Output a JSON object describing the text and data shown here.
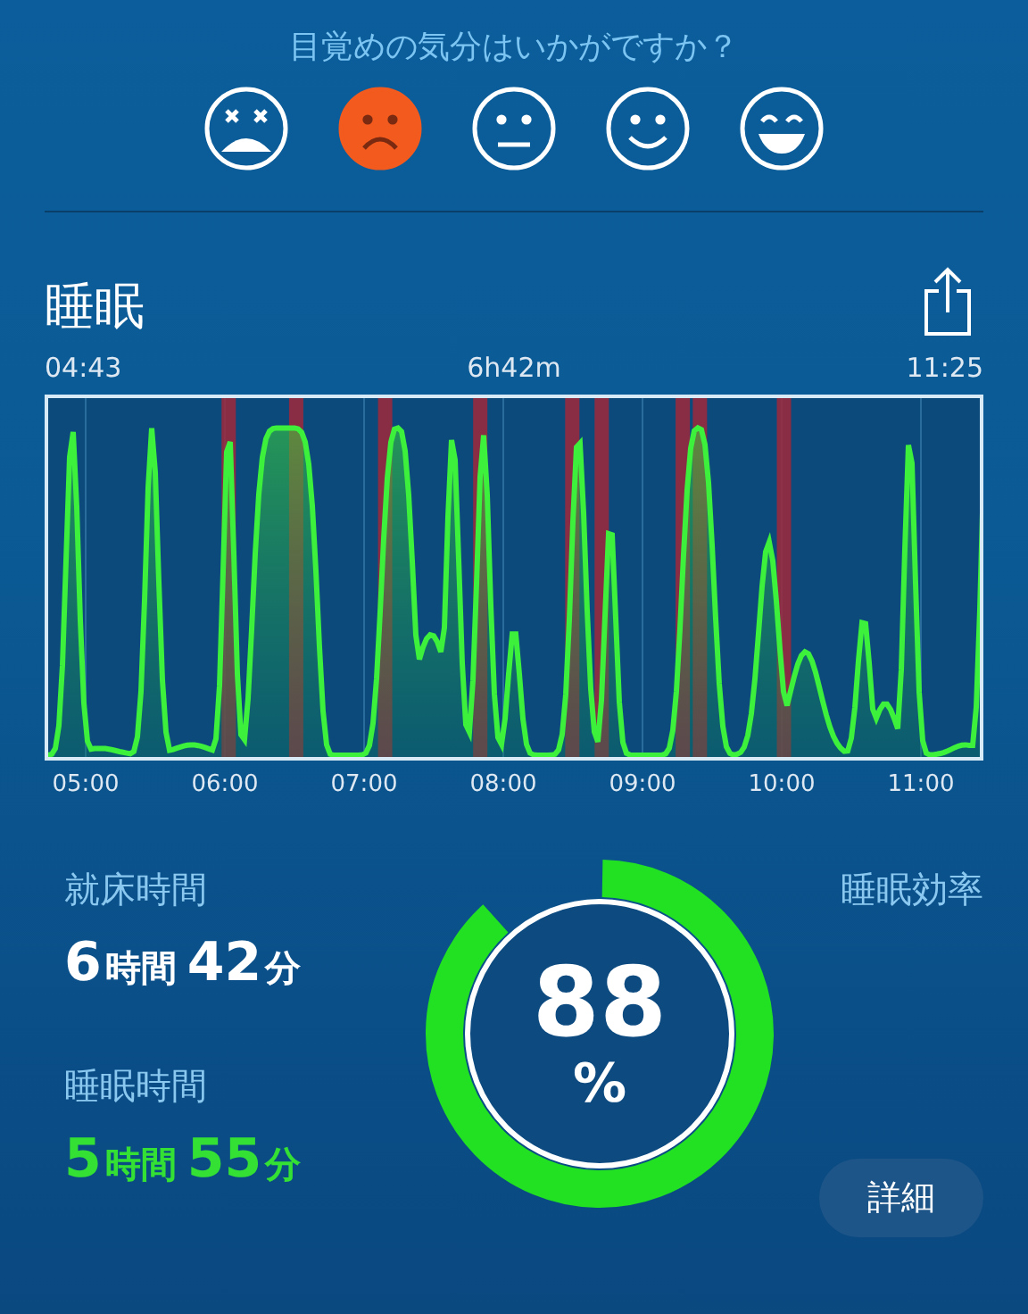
{
  "mood": {
    "question": "目覚めの気分はいかがですか？",
    "faces": [
      {
        "kind": "dizzy",
        "selected": false
      },
      {
        "kind": "sad",
        "selected": true
      },
      {
        "kind": "neutral",
        "selected": false
      },
      {
        "kind": "smile",
        "selected": false
      },
      {
        "kind": "grin",
        "selected": false
      }
    ]
  },
  "sleep": {
    "title": "睡眠",
    "start": "04:43",
    "duration": "6h42m",
    "end": "11:25",
    "x_labels": [
      "05:00",
      "06:00",
      "07:00",
      "08:00",
      "09:00",
      "10:00",
      "11:00"
    ]
  },
  "stats": [
    {
      "kind": "plain",
      "label": "就床時間",
      "hours": "6",
      "hours_unit": "時間",
      "minutes": "42",
      "minutes_unit": "分"
    },
    {
      "kind": "highlight",
      "label": "睡眠時間",
      "hours": "5",
      "hours_unit": "時間",
      "minutes": "55",
      "minutes_unit": "分"
    }
  ],
  "efficiency": {
    "label": "睡眠効率",
    "value": "88",
    "unit": "%",
    "level": 0.88
  },
  "details_button": "詳細"
}
